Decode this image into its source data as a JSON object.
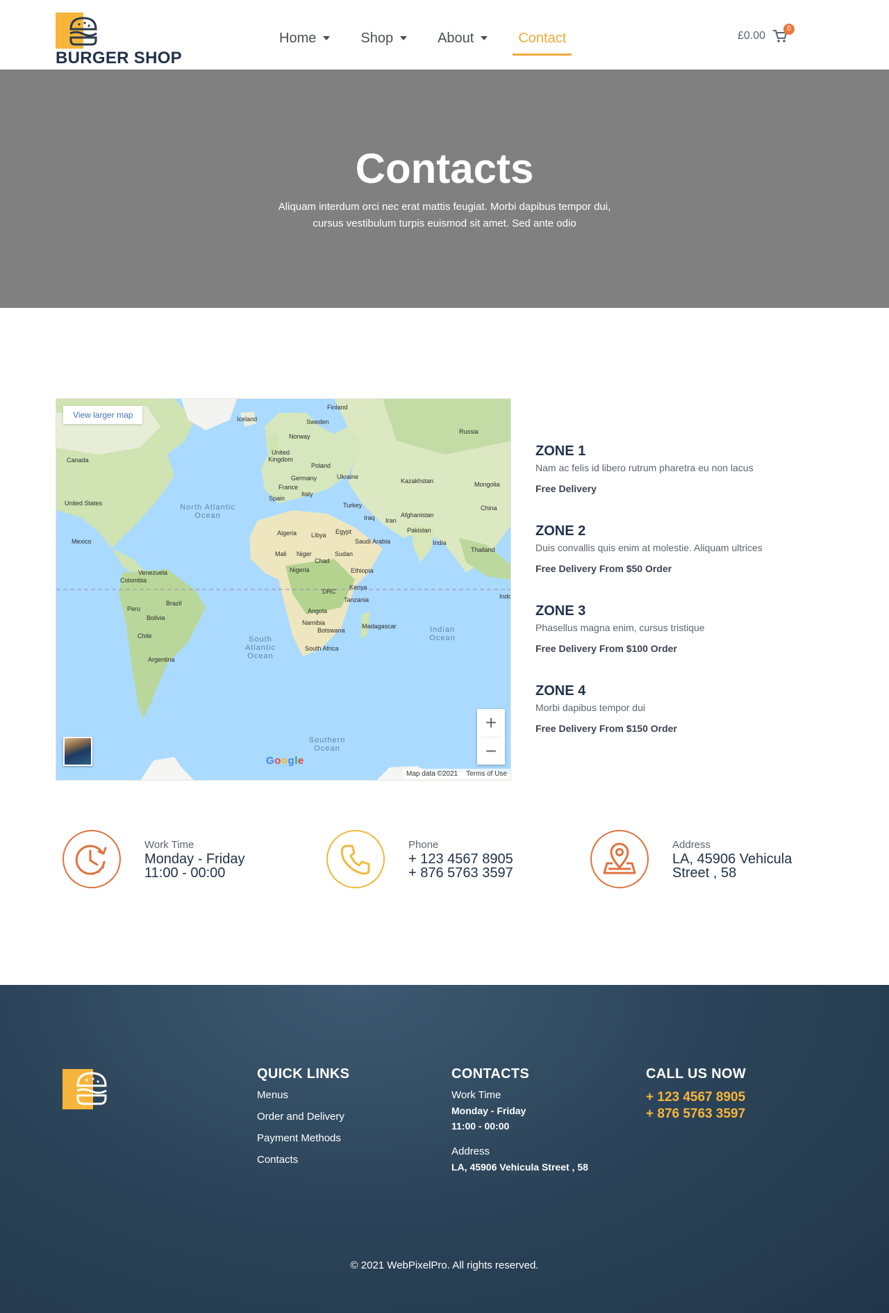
{
  "brand": {
    "name": "BURGER SHOP"
  },
  "nav": [
    {
      "label": "Home",
      "dropdown": true
    },
    {
      "label": "Shop",
      "dropdown": true
    },
    {
      "label": "About",
      "dropdown": true
    },
    {
      "label": "Contact",
      "dropdown": false,
      "active": true
    }
  ],
  "cart": {
    "price": "£0.00",
    "count": "0"
  },
  "hero": {
    "title": "Contacts",
    "subtitle": "Aliquam interdum orci nec erat mattis feugiat. Morbi dapibus tempor dui, cursus vestibulum turpis euismod sit amet. Sed ante odio"
  },
  "map": {
    "view_larger": "View larger map",
    "zoom_in": "+",
    "zoom_out": "−",
    "google": "Google",
    "map_data": "Map data ©2021",
    "terms": "Terms of Use",
    "countries": [
      "Finland",
      "Iceland",
      "Sweden",
      "Norway",
      "Russia",
      "United Kingdom",
      "Poland",
      "Canada",
      "Germany",
      "Ukraine",
      "Kazakhstan",
      "Mongolia",
      "France",
      "Italy",
      "Spain",
      "United States",
      "Turkey",
      "China",
      "Iraq",
      "Iran",
      "Afghanistan",
      "Algeria",
      "Libya",
      "Egypt",
      "Saudi Arabia",
      "Pakistan",
      "Mexico",
      "India",
      "Thailand",
      "Mali",
      "Niger",
      "Sudan",
      "Chad",
      "Nigeria",
      "Ethiopia",
      "Venezuela",
      "Colombia",
      "DRC",
      "Kenya",
      "Tanzania",
      "Indo",
      "Brazil",
      "Peru",
      "Bolivia",
      "Angola",
      "Namibia",
      "Botswana",
      "Madagascar",
      "Chile",
      "South Africa",
      "Argentina"
    ],
    "oceans": [
      "North Atlantic Ocean",
      "South Atlantic Ocean",
      "Indian Ocean",
      "Southern Ocean"
    ]
  },
  "zones": [
    {
      "title": "ZONE 1",
      "desc": "Nam ac felis id libero rutrum pharetra eu non lacus",
      "delivery": "Free Delivery"
    },
    {
      "title": "ZONE 2",
      "desc": "Duis convallis quis enim at molestie. Aliquam ultrices",
      "delivery": "Free Delivery From $50 Order"
    },
    {
      "title": "ZONE 3",
      "desc": "Phasellus magna enim, cursus tristique",
      "delivery": "Free Delivery From $100 Order"
    },
    {
      "title": "ZONE 4",
      "desc": "Morbi dapibus tempor dui",
      "delivery": "Free Delivery From $150 Order"
    }
  ],
  "info": {
    "work": {
      "label": "Work Time",
      "line1": "Monday - Friday",
      "line2": "11:00 - 00:00",
      "icon": "clock-icon",
      "color": "#e0723d"
    },
    "phone": {
      "label": "Phone",
      "line1": "+ 123 4567 8905",
      "line2": "+ 876 5763 3597",
      "icon": "phone-icon",
      "color": "#f1b93a"
    },
    "address": {
      "label": "Address",
      "line1": "LA, 45906 Vehicula",
      "line2": "Street , 58",
      "icon": "map-pin-icon",
      "color": "#e0723d"
    }
  },
  "footer": {
    "quick_links_title": "QUICK LINKS",
    "links": [
      "Menus",
      "Order and Delivery",
      "Payment Methods",
      "Contacts"
    ],
    "contacts_title": "CONTACTS",
    "work_label": "Work Time",
    "work_days": "Monday - Friday",
    "work_hours": "11:00 - 00:00",
    "address_label": "Address",
    "address": "LA, 45906 Vehicula Street , 58",
    "call_title": "CALL US NOW",
    "phone1": "+ 123 4567 8905",
    "phone2": "+ 876 5763 3597",
    "copyright": "© 2021 WebPixelPro. All rights reserved."
  },
  "colors": {
    "accent": "#f1a93a",
    "brand_yellow": "#f7b53b",
    "orange": "#e0723d",
    "dark_navy": "#23324a",
    "hero_gray": "#808080"
  }
}
